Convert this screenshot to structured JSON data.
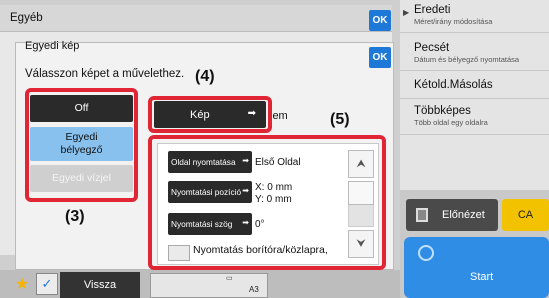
{
  "dialog1": {
    "title": "Egyéb",
    "ok_label": "OK"
  },
  "dialog2": {
    "title": "Egyedi kép",
    "prompt": "Válasszon képet a művelethez.",
    "ok_label": "OK",
    "options": {
      "off": "Off",
      "stamp": "Egyedi\nbélyegző",
      "image": "Egyedi vízjel"
    },
    "image_button": "Kép",
    "element_suffix": "lem",
    "settings": {
      "page_print_label": "Oldal nyomtatása",
      "page_print_value": "Első Oldal",
      "position_label": "Nyomtatási pozíció",
      "position_x": "X: 0 mm",
      "position_y": "Y: 0 mm",
      "angle_label": "Nyomtatási szög",
      "angle_value": "0°",
      "cover_print_label": "Nyomtatás borítóra/közlapra,"
    }
  },
  "annotations": {
    "label3": "(3)",
    "label4": "(4)",
    "label5": "(5)",
    "color": "#e02535"
  },
  "right_panel": {
    "items": [
      {
        "title": "Eredeti",
        "sub": "Méret/irány módosítása"
      },
      {
        "title": "Pecsét",
        "sub": "Dátum és bélyegző nyomtatása"
      },
      {
        "title": "Kétold.Másolás",
        "sub": ""
      },
      {
        "title": "Többképes",
        "sub": "Több oldal egy oldalra"
      }
    ],
    "preview_label": "Előnézet",
    "ca_label": "CA",
    "start_label": "Start"
  },
  "bottom": {
    "back_label": "Vissza",
    "paper_label": "A3"
  },
  "colors": {
    "accent": "#1e78d7",
    "start": "#2f8de6",
    "ca": "#f2c200",
    "selected_option": "#88c0ee"
  }
}
